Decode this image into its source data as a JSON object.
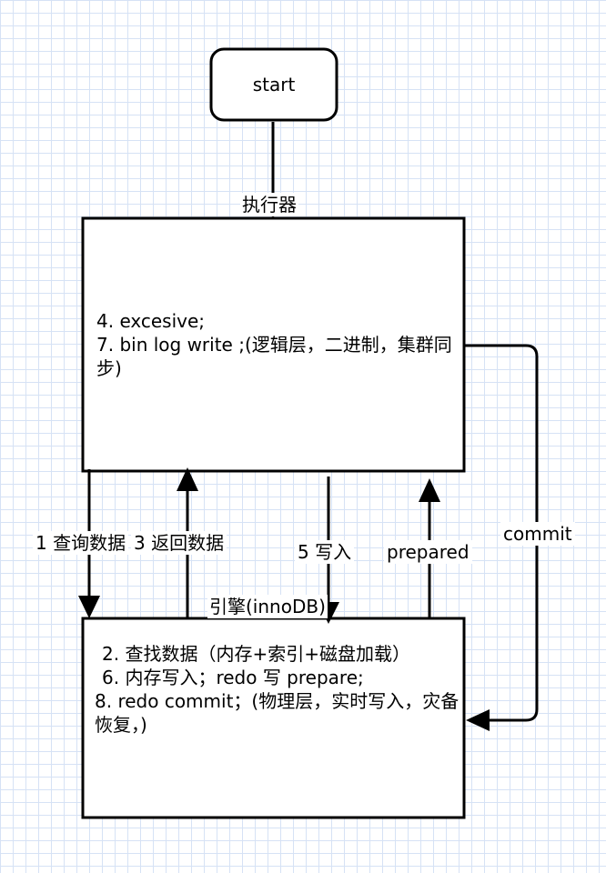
{
  "nodes": {
    "start": {
      "label": "start"
    },
    "executor": {
      "title": "执行器",
      "lines": [
        "4. excesive;",
        "7. bin log write ;(逻辑层，二进制，集群同步)"
      ]
    },
    "engine": {
      "title": "引擎(innoDB)",
      "lines": [
        "2. 查找数据（内存+索引+磁盘加载）",
        "6. 内存写入；redo 写 prepare;",
        "8. redo commit；(物理层，实时写入，灾备恢复，)"
      ]
    }
  },
  "edges": {
    "query": "1 查询数据",
    "return": "3 返回数据",
    "write": "5 写入",
    "prepared": "prepared",
    "commit": "commit"
  }
}
